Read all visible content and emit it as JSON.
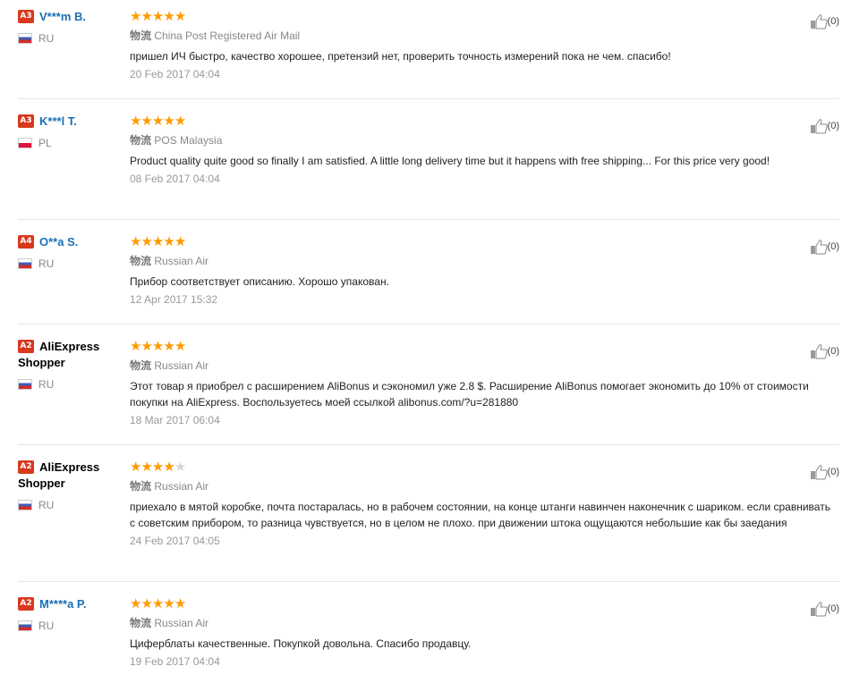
{
  "reviews": [
    {
      "level": "A3",
      "name": "V***m B.",
      "country": "RU",
      "flag": "ru",
      "stars": 5,
      "ship_label": "物流",
      "shipping": "China Post Registered Air Mail",
      "text": "пришел ИЧ быстро, качество хорошее, претензий нет, проверить точность измерений пока не чем. спасибо!",
      "date": "20 Feb 2017 04:04",
      "likes": "(0)"
    },
    {
      "level": "A3",
      "name": "K***l T.",
      "country": "PL",
      "flag": "pl",
      "stars": 5,
      "ship_label": "物流",
      "shipping": "POS Malaysia",
      "text": "Product quality quite good so finally I am satisfied. A little long delivery time but it happens with free shipping... For this price very good!",
      "date": "08 Feb 2017 04:04",
      "likes": "(0)"
    },
    {
      "level": "A4",
      "name": "O**a S.",
      "country": "RU",
      "flag": "ru",
      "stars": 5,
      "ship_label": "物流",
      "shipping": "Russian Air",
      "text": "Прибор соответствует описанию. Хорошо упакован.",
      "date": "12 Apr 2017 15:32",
      "likes": "(0)"
    },
    {
      "level": "A2",
      "name": "AliExpress Shopper",
      "country": "RU",
      "flag": "ru",
      "stars": 5,
      "ship_label": "物流",
      "shipping": "Russian Air",
      "text": "Этот товар я приобрел с расширением AliBonus и сэкономил уже 2.8 $. Расширение AliBonus помогает экономить до 10% от стоимости покупки на AliExpress. Воспользуетесь моей ссылкой alibonus.com/?u=281880",
      "date": "18 Mar 2017 06:04",
      "likes": "(0)"
    },
    {
      "level": "A2",
      "name": "AliExpress Shopper",
      "country": "RU",
      "flag": "ru",
      "stars": 4,
      "ship_label": "物流",
      "shipping": "Russian Air",
      "text": "приехало в мятой коробке, почта постаралась, но в рабочем состоянии, на конце штанги навинчен наконечник с шариком. если сравнивать с советским прибором, то разница чувствуется, но в целом не плохо. при движении штока ощущаются небольшие как бы заедания",
      "date": "24 Feb 2017 04:05",
      "likes": "(0)"
    },
    {
      "level": "A2",
      "name": "M****a P.",
      "country": "RU",
      "flag": "ru",
      "stars": 5,
      "ship_label": "物流",
      "shipping": "Russian Air",
      "text": "Циферблаты качественные. Покупкой довольна. Спасибо продавцу.",
      "date": "19 Feb 2017 04:04",
      "likes": "(0)"
    }
  ],
  "icons": {
    "star": "star-icon",
    "thumb": "thumbs-up-icon"
  },
  "colors": {
    "star": "#ff9a00",
    "level_badge": "#d8391e",
    "username": "#1a6fb5"
  }
}
